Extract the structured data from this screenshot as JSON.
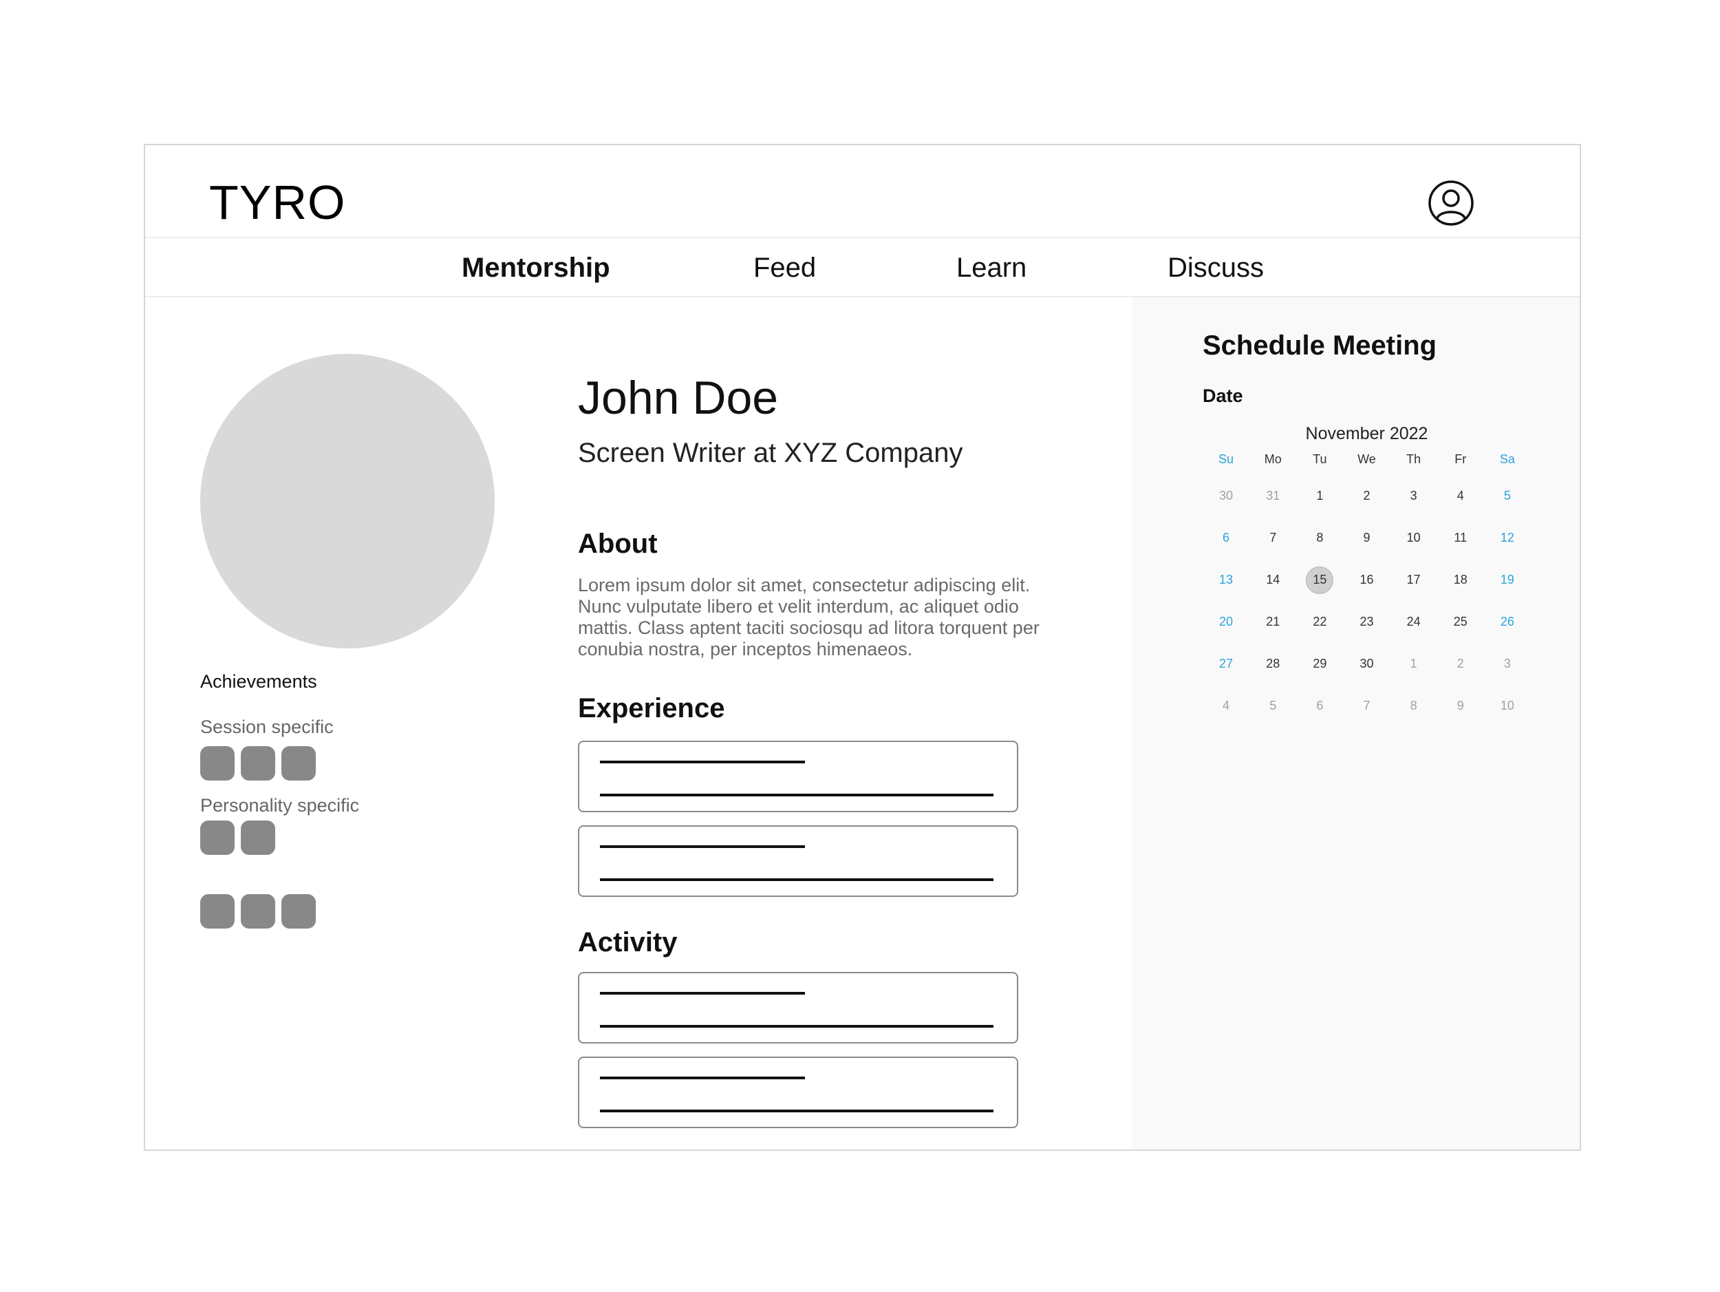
{
  "app": {
    "logo": "TYRO"
  },
  "nav": [
    {
      "label": "Mentorship",
      "active": true
    },
    {
      "label": "Feed",
      "active": false
    },
    {
      "label": "Learn",
      "active": false
    },
    {
      "label": "Discuss",
      "active": false
    }
  ],
  "profile": {
    "name": "John Doe",
    "role": "Screen Writer at XYZ Company",
    "about_title": "About",
    "about_text": "Lorem ipsum dolor sit amet, consectetur adipiscing elit. Nunc vulputate libero et velit interdum, ac aliquet odio mattis. Class aptent taciti sociosqu ad litora torquent per conubia nostra, per inceptos himenaeos.",
    "experience_title": "Experience",
    "activity_title": "Activity"
  },
  "achievements": {
    "title": "Achievements",
    "session_label": "Session specific",
    "session_badges": 3,
    "personality_label": "Personality specific",
    "personality_badges": 2,
    "other_badges": 3
  },
  "schedule": {
    "title": "Schedule Meeting",
    "date_label": "Date",
    "month": "November 2022",
    "weekdays": [
      "Su",
      "Mo",
      "Tu",
      "We",
      "Th",
      "Fr",
      "Sa"
    ],
    "weeks": [
      [
        "30",
        "31",
        "1",
        "2",
        "3",
        "4",
        "5"
      ],
      [
        "6",
        "7",
        "8",
        "9",
        "10",
        "11",
        "12"
      ],
      [
        "13",
        "14",
        "15",
        "16",
        "17",
        "18",
        "19"
      ],
      [
        "20",
        "21",
        "22",
        "23",
        "24",
        "25",
        "26"
      ],
      [
        "27",
        "28",
        "29",
        "30",
        "1",
        "2",
        "3"
      ],
      [
        "4",
        "5",
        "6",
        "7",
        "8",
        "9",
        "10"
      ]
    ],
    "selected_day": "15",
    "accent_color": "#2aa3dc"
  },
  "colors": {
    "badge": "#888888",
    "avatar": "#d9d9d9",
    "sidebar_bg": "#f9f9f9"
  }
}
